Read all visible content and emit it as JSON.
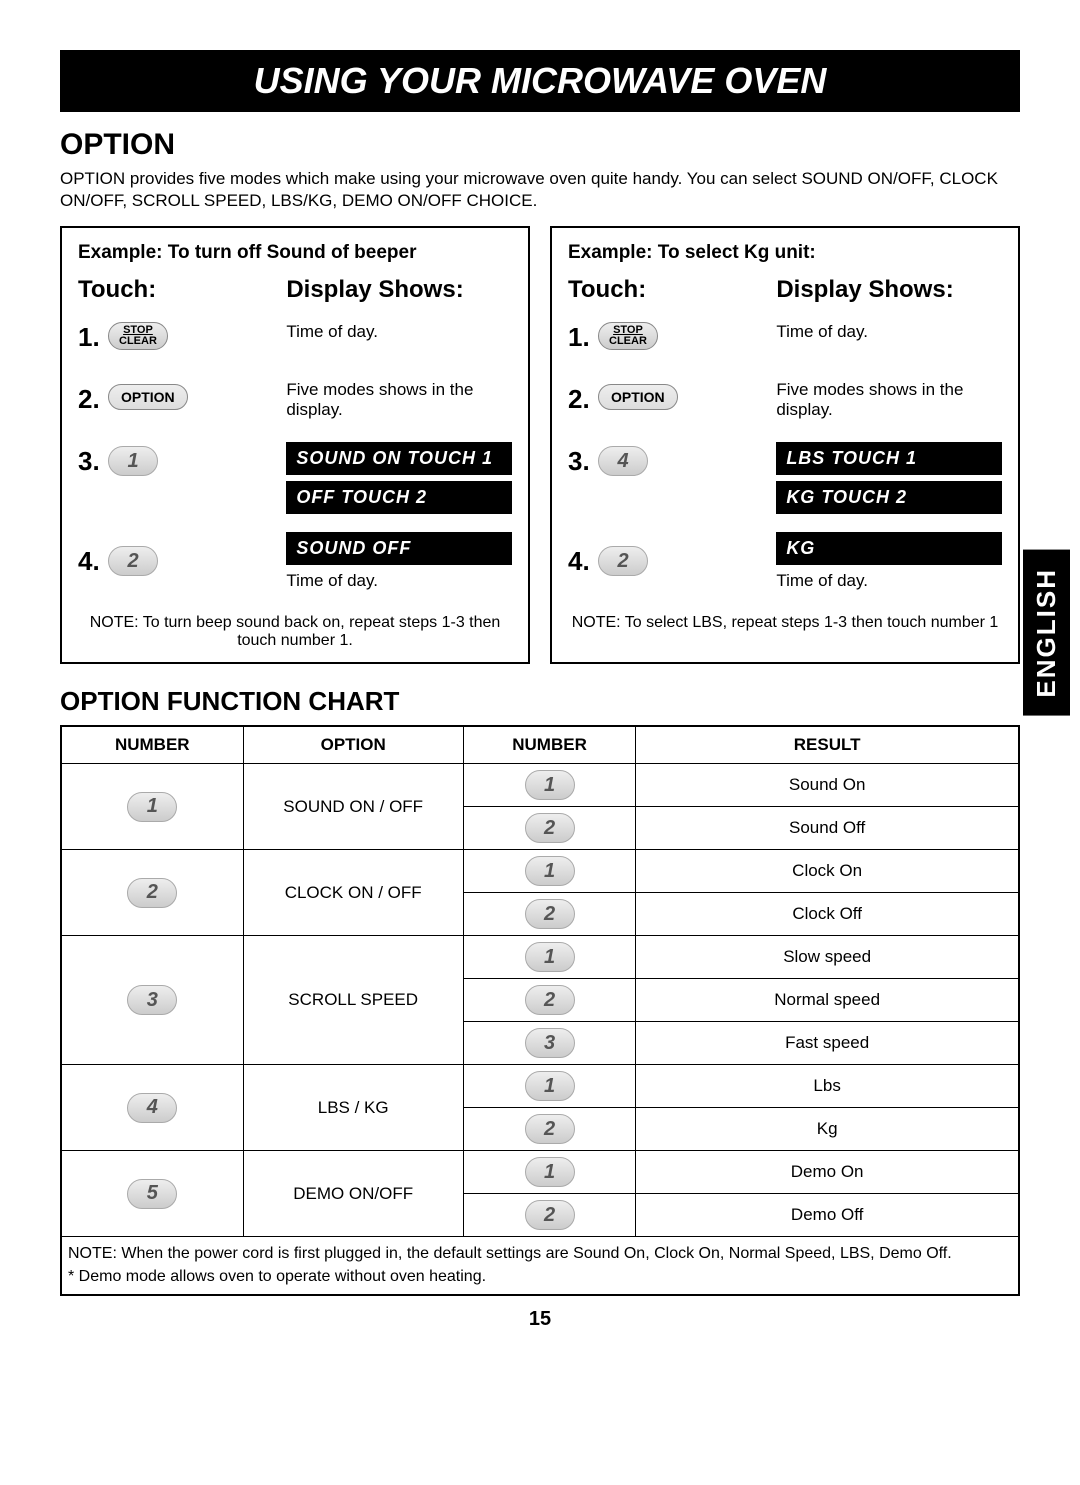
{
  "banner": "USING YOUR MICROWAVE OVEN",
  "side_tab": "ENGLISH",
  "option": {
    "title": "OPTION",
    "intro": "OPTION provides five modes which make using your microwave oven quite handy. You can select SOUND ON/OFF, CLOCK ON/OFF, SCROLL SPEED, LBS/KG, DEMO ON/OFF CHOICE."
  },
  "ex1": {
    "title": "Example: To turn off Sound of beeper",
    "touch": "Touch:",
    "display": "Display Shows:",
    "s1_btn_top": "STOP",
    "s1_btn_bot": "CLEAR",
    "s1_disp": "Time of day.",
    "s2_btn": "OPTION",
    "s2_disp": "Five modes shows in the display.",
    "s3_num": "1",
    "s3_disp_a": "SOUND ON TOUCH 1",
    "s3_disp_b": "OFF TOUCH 2",
    "s4_num": "2",
    "s4_disp_a": "SOUND OFF",
    "s4_disp_b": "Time of day.",
    "note": "NOTE: To turn beep sound back on, repeat steps 1-3 then touch number 1."
  },
  "ex2": {
    "title": "Example: To select Kg unit:",
    "touch": "Touch:",
    "display": "Display Shows:",
    "s1_btn_top": "STOP",
    "s1_btn_bot": "CLEAR",
    "s1_disp": "Time of day.",
    "s2_btn": "OPTION",
    "s2_disp": "Five modes shows in the display.",
    "s3_num": "4",
    "s3_disp_a": "LBS TOUCH 1",
    "s3_disp_b": "KG TOUCH 2",
    "s4_num": "2",
    "s4_disp_a": "KG",
    "s4_disp_b": "Time of day.",
    "note": "NOTE: To select LBS, repeat steps 1-3 then touch number 1"
  },
  "chart": {
    "title": "OPTION FUNCTION CHART",
    "h1": "NUMBER",
    "h2": "OPTION",
    "h3": "NUMBER",
    "h4": "RESULT",
    "rows": [
      {
        "n1": "1",
        "opt": "SOUND ON / OFF",
        "sub": [
          {
            "n": "1",
            "r": "Sound On"
          },
          {
            "n": "2",
            "r": "Sound Off"
          }
        ]
      },
      {
        "n1": "2",
        "opt": "CLOCK ON / OFF",
        "sub": [
          {
            "n": "1",
            "r": "Clock On"
          },
          {
            "n": "2",
            "r": "Clock Off"
          }
        ]
      },
      {
        "n1": "3",
        "opt": "SCROLL SPEED",
        "sub": [
          {
            "n": "1",
            "r": "Slow speed"
          },
          {
            "n": "2",
            "r": "Normal speed"
          },
          {
            "n": "3",
            "r": "Fast speed"
          }
        ]
      },
      {
        "n1": "4",
        "opt": "LBS / KG",
        "sub": [
          {
            "n": "1",
            "r": "Lbs"
          },
          {
            "n": "2",
            "r": "Kg"
          }
        ]
      },
      {
        "n1": "5",
        "opt": "DEMO ON/OFF",
        "sub": [
          {
            "n": "1",
            "r": "Demo On"
          },
          {
            "n": "2",
            "r": "Demo Off"
          }
        ]
      }
    ],
    "note": "NOTE: When the power cord is first plugged in, the default settings are Sound On, Clock On, Normal Speed, LBS, Demo Off.\n          * Demo mode allows oven to operate without oven heating."
  },
  "page_number": "15"
}
